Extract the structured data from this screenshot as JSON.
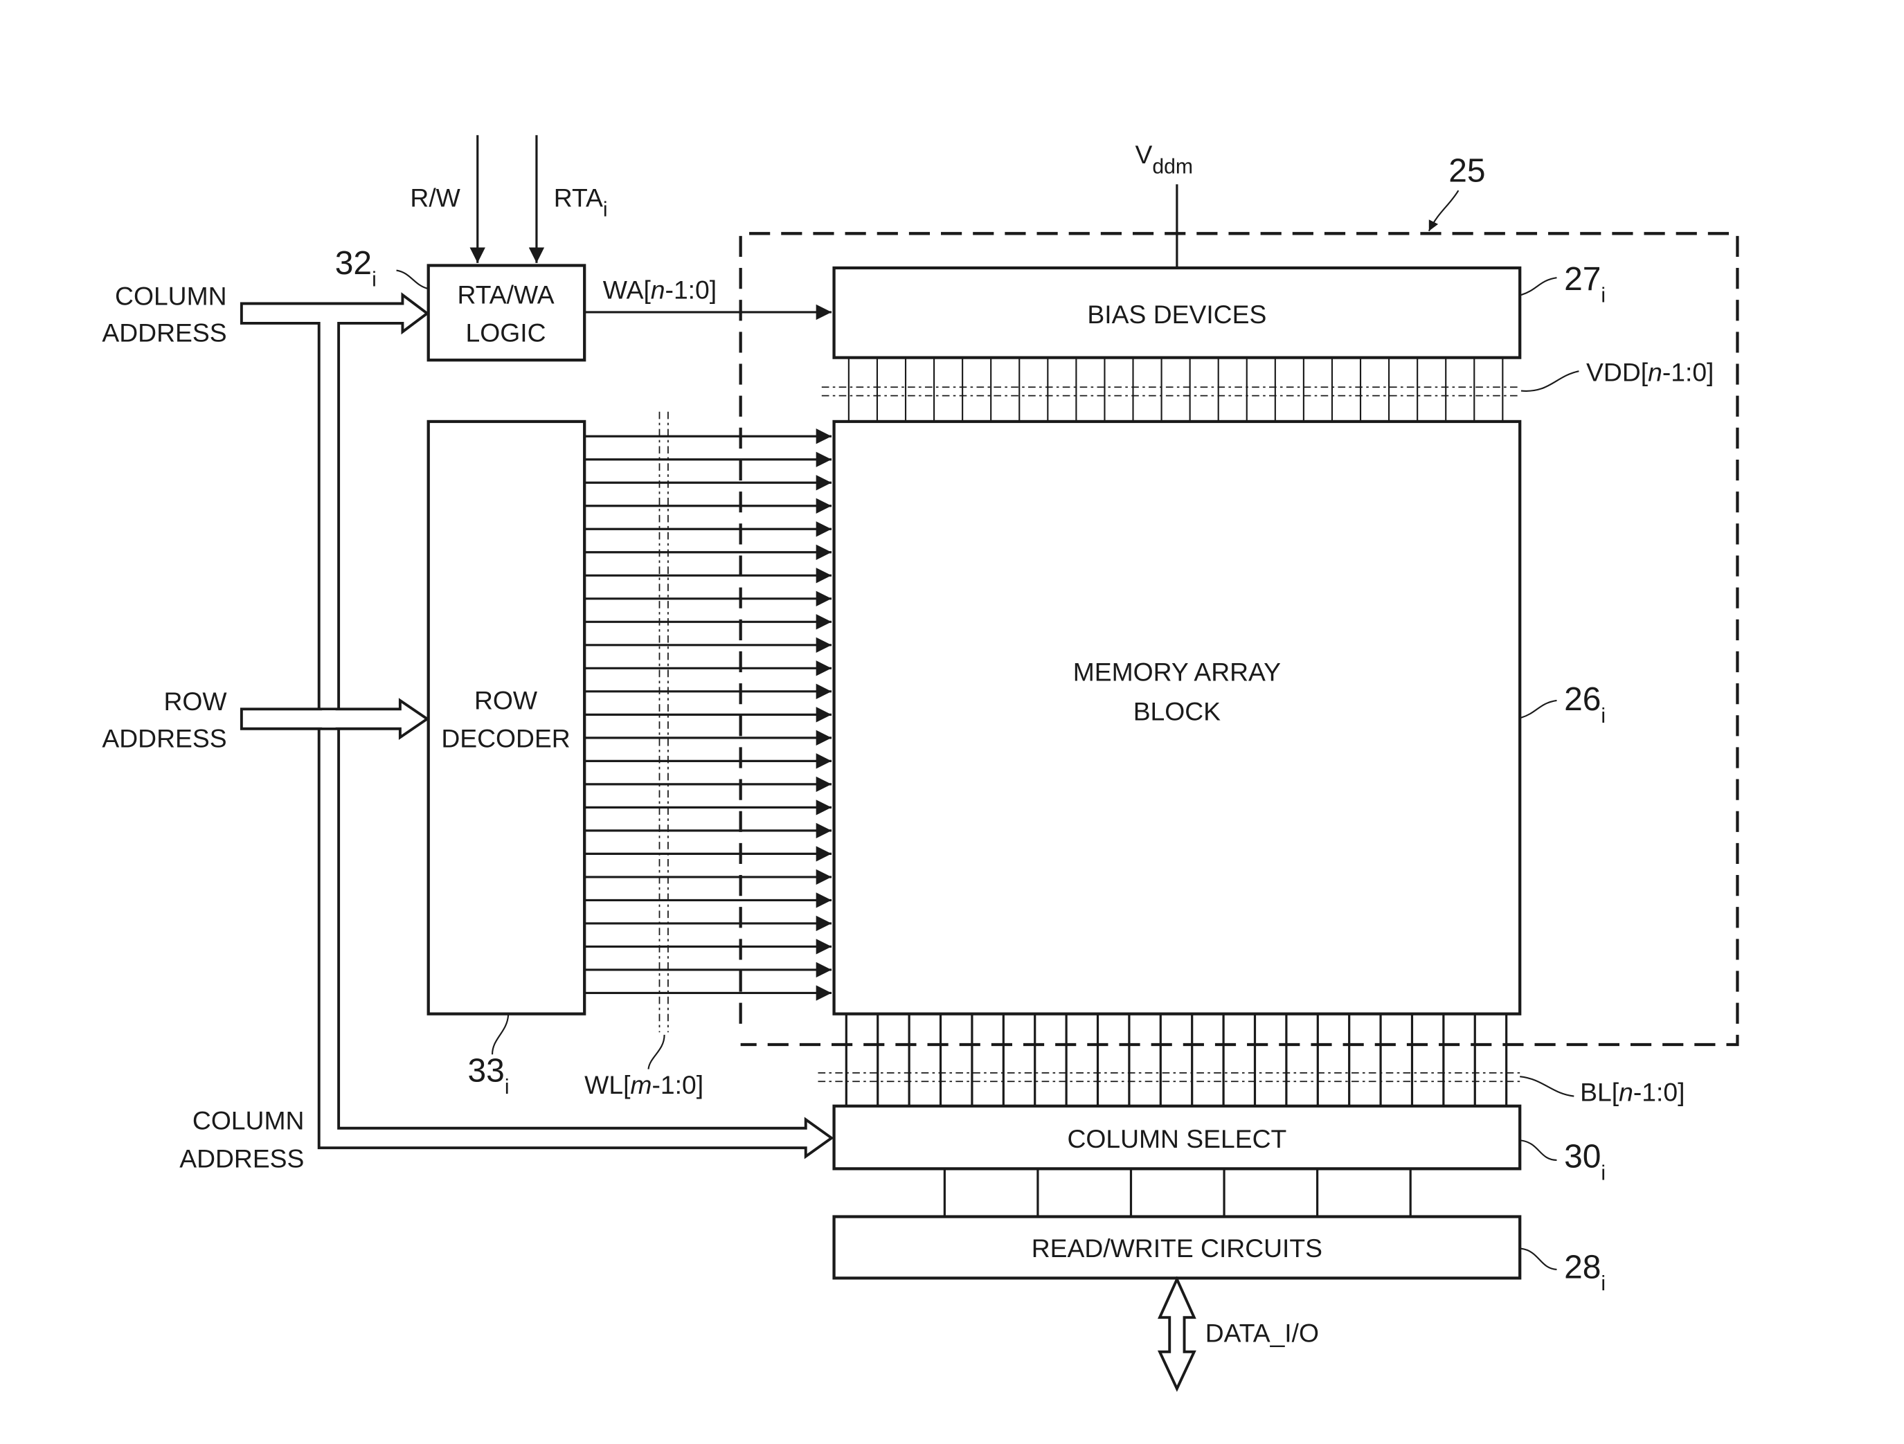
{
  "figure": {
    "container_ref": "25",
    "supply_label": "V",
    "supply_sub": "ddm"
  },
  "inputs": {
    "rw": "R/W",
    "rta": "RTA",
    "rta_sub": "i",
    "column_address_top": [
      "COLUMN",
      "ADDRESS"
    ],
    "row_address": [
      "ROW",
      "ADDRESS"
    ],
    "column_address_bottom": [
      "COLUMN",
      "ADDRESS"
    ]
  },
  "blocks": {
    "rta_wa_logic": {
      "lines": [
        "RTA/WA",
        "LOGIC"
      ],
      "ref": "32",
      "ref_sub": "i"
    },
    "row_decoder": {
      "lines": [
        "ROW",
        "DECODER"
      ],
      "ref": "33",
      "ref_sub": "i"
    },
    "bias_devices": {
      "label": "BIAS DEVICES",
      "ref": "27",
      "ref_sub": "i"
    },
    "memory_array": {
      "lines": [
        "MEMORY ARRAY",
        "BLOCK"
      ],
      "ref": "26",
      "ref_sub": "i"
    },
    "column_select": {
      "label": "COLUMN SELECT",
      "ref": "30",
      "ref_sub": "i"
    },
    "read_write": {
      "label": "READ/WRITE CIRCUITS",
      "ref": "28",
      "ref_sub": "i"
    }
  },
  "signals": {
    "wa": {
      "prefix": "WA[",
      "var": "n",
      "suffix": "-1:0]"
    },
    "vdd": {
      "prefix": "VDD[",
      "var": "n",
      "suffix": "-1:0]"
    },
    "wl": {
      "prefix": "WL[",
      "var": "m",
      "suffix": "-1:0]"
    },
    "bl": {
      "prefix": "BL[",
      "var": "n",
      "suffix": "-1:0]"
    },
    "data_io": "DATA_I/O"
  },
  "counts": {
    "wordlines": 25,
    "vdd_lines": 24,
    "bitlines": 22,
    "col_select_outputs": 6
  }
}
